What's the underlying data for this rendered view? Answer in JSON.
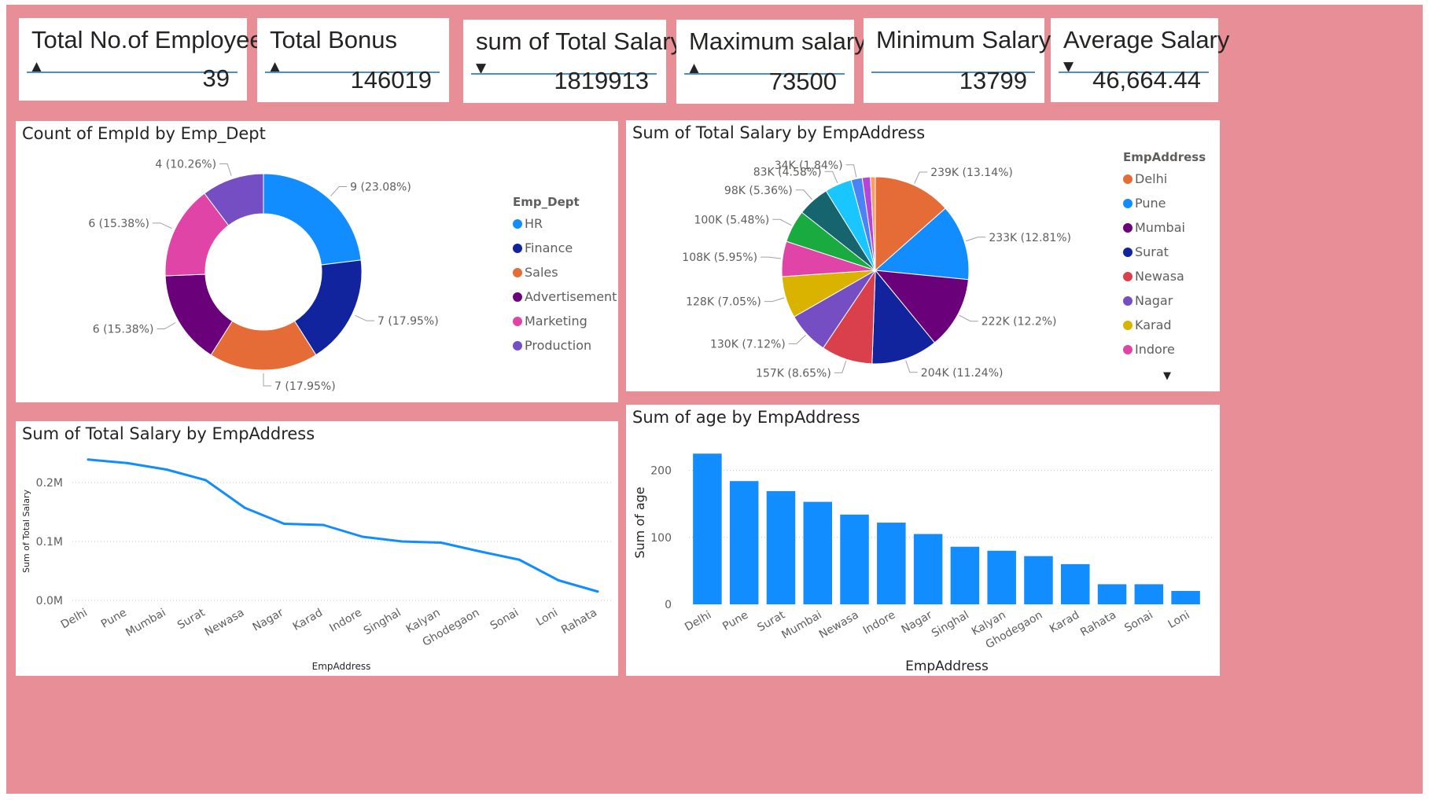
{
  "kpis": [
    {
      "title": "Total No.of Employees",
      "trend": "up",
      "value": "39"
    },
    {
      "title": "Total Bonus",
      "trend": "up",
      "value": "146019"
    },
    {
      "title": "sum of Total Salary",
      "trend": "down",
      "value": "1819913"
    },
    {
      "title": "Maximum salary",
      "trend": "up",
      "value": "73500"
    },
    {
      "title": "Minimum Salary",
      "trend": "none",
      "value": "13799"
    },
    {
      "title": "Average Salary",
      "trend": "down",
      "value": "46,664.44"
    }
  ],
  "donut": {
    "title": "Count of EmpId by Emp_Dept",
    "legend_title": "Emp_Dept"
  },
  "pie": {
    "title": "Sum of Total Salary by EmpAddress",
    "legend_title": "EmpAddress",
    "legend_more": "▼"
  },
  "line": {
    "title": "Sum of Total Salary by EmpAddress"
  },
  "bar": {
    "title": "Sum of age by EmpAddress"
  },
  "chart_data": [
    {
      "type": "donut",
      "title": "Count of EmpId by Emp_Dept",
      "legend_title": "Emp_Dept",
      "categories": [
        "HR",
        "Finance",
        "Sales",
        "Advertisement",
        "Marketing",
        "Production"
      ],
      "values": [
        9,
        7,
        7,
        6,
        6,
        4
      ],
      "data_labels": [
        "9 (23.08%)",
        "7 (17.95%)",
        "7 (17.95%)",
        "6 (15.38%)",
        "6 (15.38%)",
        "4 (10.26%)"
      ],
      "colors": [
        "#118dff",
        "#12239e",
        "#e66c37",
        "#6b007b",
        "#e044a7",
        "#744ec2"
      ],
      "legend_position": "right"
    },
    {
      "type": "pie",
      "title": "Sum of Total Salary by EmpAddress",
      "legend_title": "EmpAddress",
      "categories": [
        "Delhi",
        "Pune",
        "Mumbai",
        "Surat",
        "Newasa",
        "Nagar",
        "Karad",
        "Indore",
        "Singhal",
        "Kalyan",
        "Ghodegaon",
        "Sonai",
        "Loni",
        "Rahata"
      ],
      "values": [
        239000,
        233000,
        222000,
        204000,
        157000,
        130000,
        128000,
        108000,
        100000,
        98000,
        83000,
        34000,
        25000,
        15000
      ],
      "data_labels": [
        "239K (13.14%)",
        "233K (12.81%)",
        "222K (12.2%)",
        "204K (11.24%)",
        "157K (8.65%)",
        "130K (7.12%)",
        "128K (7.05%)",
        "108K (5.95%)",
        "100K (5.48%)",
        "98K (5.36%)",
        "83K (4.58%)",
        "34K (1.84%)",
        "",
        ""
      ],
      "colors": [
        "#e66c37",
        "#118dff",
        "#6b007b",
        "#12239e",
        "#d9404c",
        "#744ec2",
        "#d9b300",
        "#e044a7",
        "#1aab40",
        "#15646e",
        "#1ac6ff",
        "#4b82f5",
        "#b345d8",
        "#fd9b62"
      ],
      "legend_visible": [
        "Delhi",
        "Pune",
        "Mumbai",
        "Surat",
        "Newasa",
        "Nagar",
        "Karad",
        "Indore"
      ],
      "legend_position": "right"
    },
    {
      "type": "line",
      "title": "Sum of Total Salary by EmpAddress",
      "xlabel": "EmpAddress",
      "ylabel": "Sum of Total Salary",
      "categories": [
        "Delhi",
        "Pune",
        "Mumbai",
        "Surat",
        "Newasa",
        "Nagar",
        "Karad",
        "Indore",
        "Singhal",
        "Kalyan",
        "Ghodegaon",
        "Sonai",
        "Loni",
        "Rahata"
      ],
      "values": [
        239000,
        233000,
        222000,
        204000,
        157000,
        130000,
        128000,
        108000,
        100000,
        98000,
        83000,
        69000,
        34000,
        15000
      ],
      "yticks": [
        "0.0M",
        "0.1M",
        "0.2M"
      ],
      "ytick_values": [
        0,
        100000,
        200000
      ],
      "ylim": [
        0,
        240000
      ],
      "color": "#118dff"
    },
    {
      "type": "bar",
      "title": "Sum of age by EmpAddress",
      "xlabel": "EmpAddress",
      "ylabel": "Sum of age",
      "categories": [
        "Delhi",
        "Pune",
        "Surat",
        "Mumbai",
        "Newasa",
        "Indore",
        "Nagar",
        "Singhal",
        "Kalyan",
        "Ghodegaon",
        "Karad",
        "Rahata",
        "Sonai",
        "Loni"
      ],
      "values": [
        225,
        184,
        169,
        153,
        134,
        122,
        105,
        86,
        80,
        72,
        60,
        30,
        30,
        20
      ],
      "yticks": [
        "0",
        "100",
        "200"
      ],
      "ytick_values": [
        0,
        100,
        200
      ],
      "ylim": [
        0,
        230
      ],
      "color": "#118dff"
    }
  ]
}
